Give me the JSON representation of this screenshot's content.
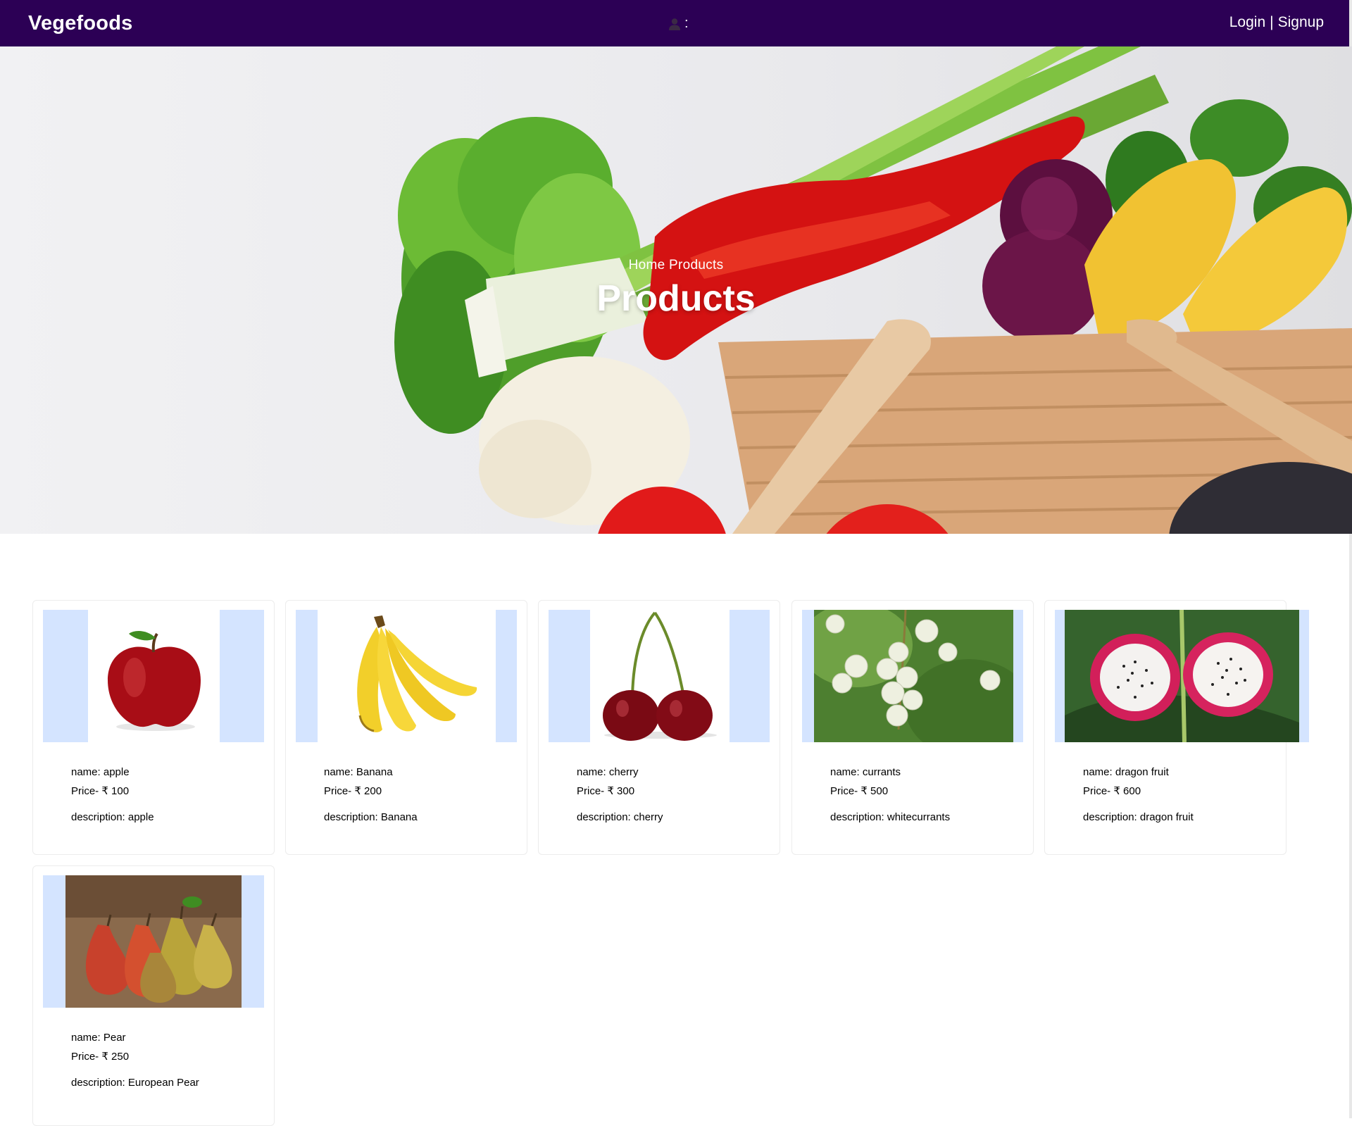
{
  "nav": {
    "brand": "Vegefoods",
    "user_suffix": ":",
    "login": "Login",
    "separator": "|",
    "signup": "Signup",
    "icon": "user-icon",
    "bg_color": "#2c0055"
  },
  "hero": {
    "breadcrumb_home": "Home",
    "breadcrumb_current": "Products",
    "title": "Products"
  },
  "products": [
    {
      "name": "name: apple",
      "price": "Price- ₹ 100",
      "description": "description: apple"
    },
    {
      "name": "name: Banana",
      "price": "Price- ₹ 200",
      "description": "description: Banana"
    },
    {
      "name": "name: cherry",
      "price": "Price- ₹ 300",
      "description": "description: cherry"
    },
    {
      "name": "name: currants",
      "price": "Price- ₹ 500",
      "description": "description: whitecurrants"
    },
    {
      "name": "name: dragon fruit",
      "price": "Price- ₹ 600",
      "description": "description: dragon fruit"
    },
    {
      "name": "name: Pear",
      "price": "Price- ₹ 250",
      "description": "description: European Pear"
    }
  ]
}
